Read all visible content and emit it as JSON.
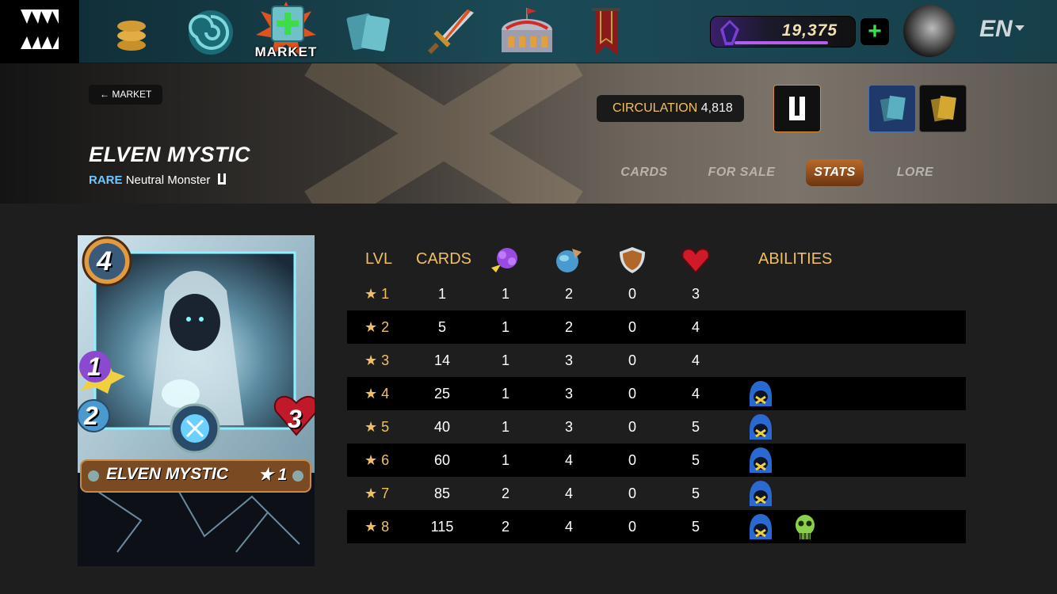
{
  "nav": {
    "market_label": "MARKET",
    "items": [
      "logo-icon",
      "coins-icon",
      "swirl-icon",
      "market-icon",
      "cards-icon",
      "sword-icon",
      "arena-icon",
      "banner-icon"
    ]
  },
  "wallet": {
    "dec_amount": "19,375",
    "plus_label": "+"
  },
  "language": {
    "label": "EN"
  },
  "header": {
    "back_label": "MARKET",
    "circulation_label": "CIRCULATION",
    "circulation_value": "4,818",
    "title": "ELVEN MYSTIC",
    "rarity": "RARE",
    "type": "Neutral Monster"
  },
  "tabs": [
    {
      "label": "CARDS",
      "active": false
    },
    {
      "label": "FOR SALE",
      "active": false
    },
    {
      "label": "STATS",
      "active": true
    },
    {
      "label": "LORE",
      "active": false
    }
  ],
  "card": {
    "mana": "4",
    "attack": "1",
    "speed": "2",
    "health": "3",
    "name": "ELVEN MYSTIC",
    "level": "★ 1"
  },
  "table": {
    "headers": {
      "lvl": "LVL",
      "cards": "CARDS",
      "abilities": "ABILITIES"
    },
    "stat_icons": [
      "magic-attack-icon",
      "speed-icon",
      "armor-icon",
      "health-icon"
    ],
    "rows": [
      {
        "lvl": "★ 1",
        "cards": "1",
        "magic": "1",
        "speed": "2",
        "armor": "0",
        "health": "3",
        "abilities": []
      },
      {
        "lvl": "★ 2",
        "cards": "5",
        "magic": "1",
        "speed": "2",
        "armor": "0",
        "health": "4",
        "abilities": []
      },
      {
        "lvl": "★ 3",
        "cards": "14",
        "magic": "1",
        "speed": "3",
        "armor": "0",
        "health": "4",
        "abilities": []
      },
      {
        "lvl": "★ 4",
        "cards": "25",
        "magic": "1",
        "speed": "3",
        "armor": "0",
        "health": "4",
        "abilities": [
          "silence-icon"
        ]
      },
      {
        "lvl": "★ 5",
        "cards": "40",
        "magic": "1",
        "speed": "3",
        "armor": "0",
        "health": "5",
        "abilities": [
          "silence-icon"
        ]
      },
      {
        "lvl": "★ 6",
        "cards": "60",
        "magic": "1",
        "speed": "4",
        "armor": "0",
        "health": "5",
        "abilities": [
          "silence-icon"
        ]
      },
      {
        "lvl": "★ 7",
        "cards": "85",
        "magic": "2",
        "speed": "4",
        "armor": "0",
        "health": "5",
        "abilities": [
          "silence-icon"
        ]
      },
      {
        "lvl": "★ 8",
        "cards": "115",
        "magic": "2",
        "speed": "4",
        "armor": "0",
        "health": "5",
        "abilities": [
          "silence-icon",
          "affliction-icon"
        ]
      }
    ]
  }
}
